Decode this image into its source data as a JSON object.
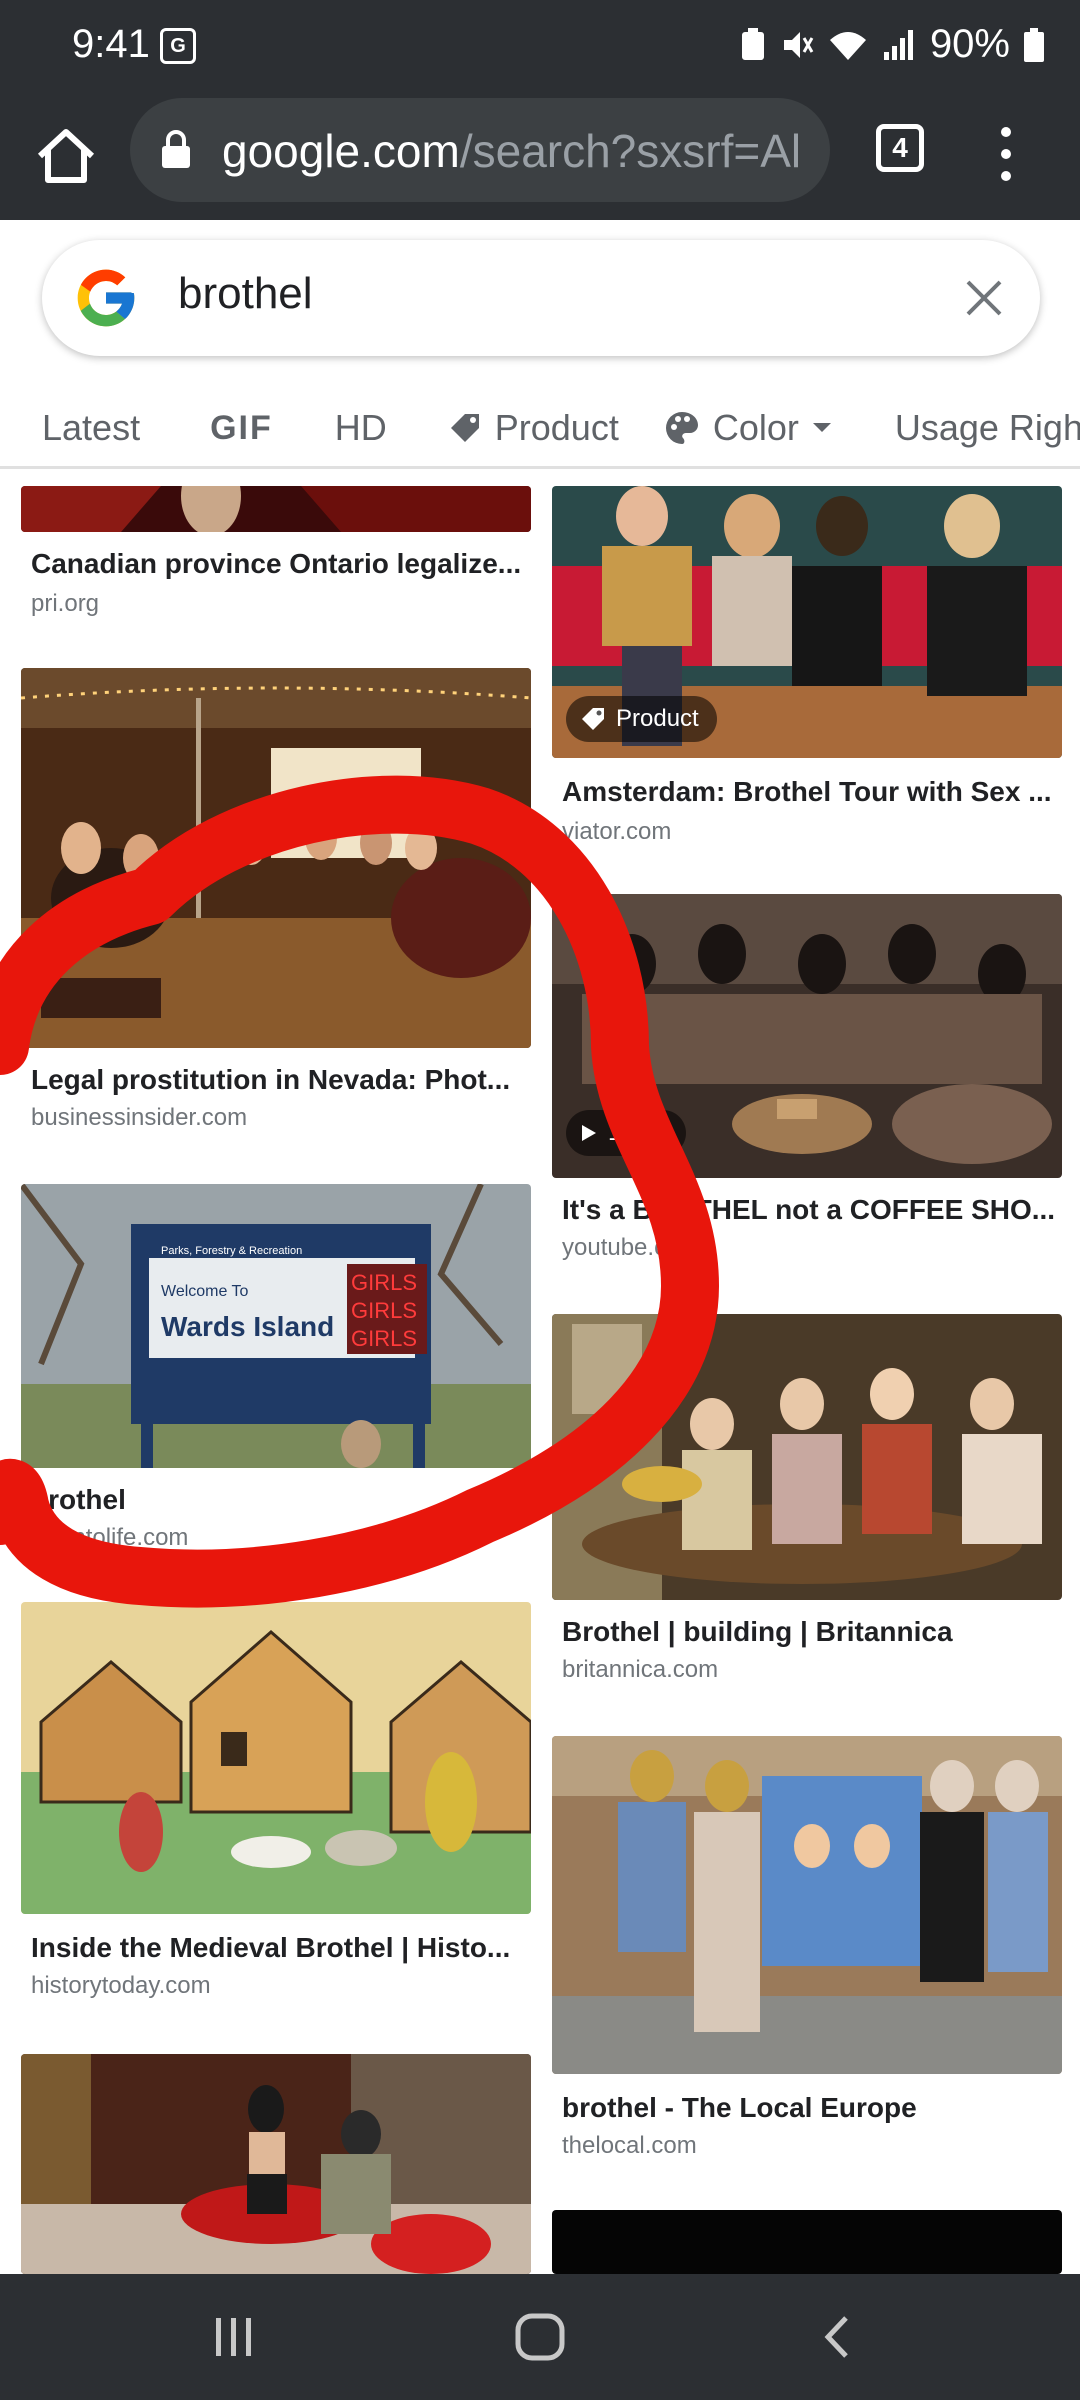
{
  "status_bar": {
    "time": "9:41",
    "battery": "90%"
  },
  "browser": {
    "url_host": "google.com",
    "url_path": "/search?sxsrf=Al",
    "tab_count": "4"
  },
  "search": {
    "query": "brothel"
  },
  "filters": [
    "Latest",
    "GIF",
    "HD",
    "Product",
    "Color",
    "Usage Righ"
  ],
  "results": {
    "left": [
      {
        "title": "Canadian province Ontario legalize...",
        "source": "pri.org"
      },
      {
        "title": "Legal prostitution in Nevada: Phot...",
        "source": "businessinsider.com"
      },
      {
        "title": "brothel",
        "source": "torontolife.com"
      },
      {
        "title": "Inside the Medieval Brothel | Histo...",
        "source": "historytoday.com"
      }
    ],
    "right": [
      {
        "title": "Amsterdam: Brothel Tour with Sex ...",
        "source": "viator.com",
        "badge": "Product"
      },
      {
        "title": "It's a BROTHEL not a COFFEE SHO...",
        "source": "youtube.com",
        "badge": "19:43"
      },
      {
        "title": "Brothel | building | Britannica",
        "source": "britannica.com"
      },
      {
        "title": "brothel - The Local Europe",
        "source": "thelocal.com"
      }
    ]
  },
  "sign_text": {
    "line1": "Parks, Forestry & Recreation",
    "line2": "Welcome To",
    "line3": "Wards Island",
    "neon": "GIRLS"
  },
  "colors": {
    "chrome_bg": "#2c2f33",
    "annotation_red": "#e8160c",
    "link_gray": "#70757a"
  }
}
